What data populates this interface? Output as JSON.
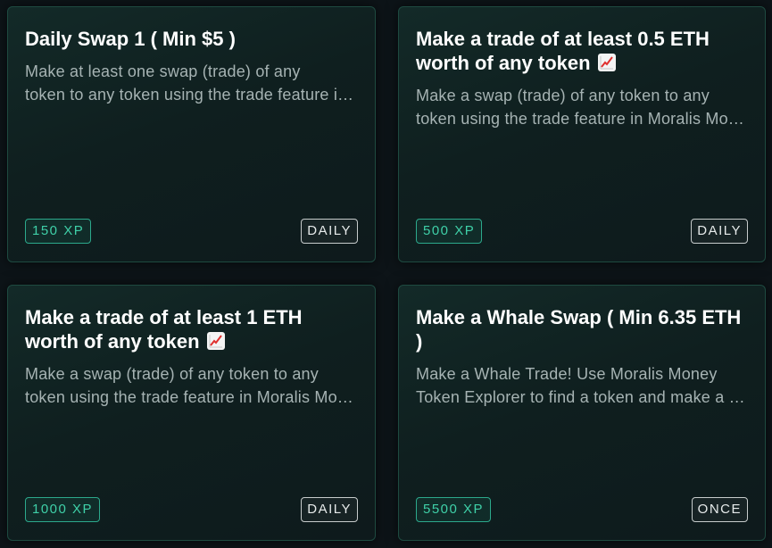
{
  "quests": [
    {
      "title": "Daily Swap 1 ( Min $5 )",
      "has_emoji": false,
      "description_lines": [
        "Make at least one swap (trade) of any",
        "token to any token using the trade feature in Moralis Money"
      ],
      "xp": "150 XP",
      "frequency": "DAILY"
    },
    {
      "title": "Make a trade of at least 0.5 ETH worth of any token",
      "has_emoji": true,
      "emoji_icon": "chart-increasing-icon",
      "description_lines": [
        "Make a swap (trade) of any token to any",
        "token using the trade feature in Moralis Money"
      ],
      "xp": "500 XP",
      "frequency": "DAILY"
    },
    {
      "title": "Make a trade of at least 1 ETH worth of any token",
      "has_emoji": true,
      "emoji_icon": "chart-increasing-icon",
      "description_lines": [
        "Make a swap (trade) of any token to any",
        "token using the trade feature in Moralis Money"
      ],
      "xp": "1000 XP",
      "frequency": "DAILY"
    },
    {
      "title": "Make a Whale Swap ( Min 6.35 ETH )",
      "has_emoji": false,
      "description_lines": [
        "Make a Whale Trade! Use Moralis Money",
        "Token Explorer to find a token and make a trade"
      ],
      "xp": "5500 XP",
      "frequency": "ONCE"
    }
  ],
  "colors": {
    "background": "#0d1418",
    "card_border": "#1e4a40",
    "xp_accent": "#3fd0a8",
    "badge_border": "#c7cccc"
  }
}
